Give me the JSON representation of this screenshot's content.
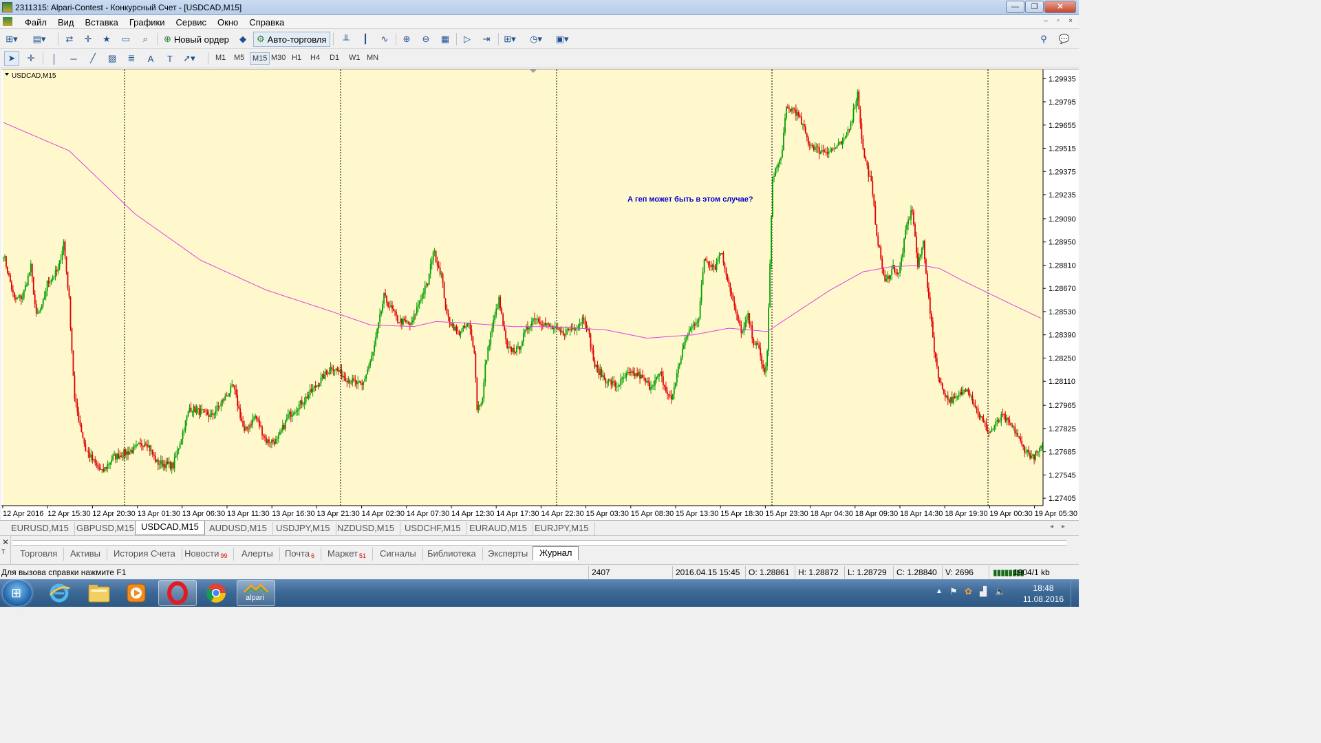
{
  "window": {
    "title": "2311315: Alpari-Contest - Конкурсный Счет - [USDCAD,M15]",
    "buttons": [
      "—",
      "❐",
      "✕"
    ]
  },
  "menu": {
    "items": [
      "Файл",
      "Вид",
      "Вставка",
      "Графики",
      "Сервис",
      "Окно",
      "Справка"
    ],
    "mdi_buttons": [
      "–",
      "▫",
      "×"
    ]
  },
  "toolbar": {
    "new_order_label": "Новый ордер",
    "auto_trading_label": "Авто-торговля",
    "timeframes": [
      "M1",
      "M5",
      "M15",
      "M30",
      "H1",
      "H4",
      "D1",
      "W1",
      "MN"
    ],
    "active_timeframe": "M15"
  },
  "chart": {
    "symbol_label": "USDCAD,M15",
    "annotation": "А геп может быть в этом случае?",
    "background_color": "#fff8cd",
    "bull_color": "#00a000",
    "bear_color": "#e00000",
    "ma_color": "#e040e0",
    "annotation_color": "#0000d0"
  },
  "chart_data": {
    "type": "candlestick",
    "symbol": "USDCAD",
    "timeframe": "M15",
    "y_ticks": [
      "1.29935",
      "1.29795",
      "1.29655",
      "1.29515",
      "1.29375",
      "1.29235",
      "1.29090",
      "1.28950",
      "1.28810",
      "1.28670",
      "1.28530",
      "1.28390",
      "1.28250",
      "1.28110",
      "1.27965",
      "1.27825",
      "1.27685",
      "1.27545",
      "1.27405"
    ],
    "ylim": [
      1.2736,
      1.2999
    ],
    "x_ticks": [
      "12 Apr 2016",
      "12 Apr 15:30",
      "12 Apr 20:30",
      "13 Apr 01:30",
      "13 Apr 06:30",
      "13 Apr 11:30",
      "13 Apr 16:30",
      "13 Apr 21:30",
      "14 Apr 02:30",
      "14 Apr 07:30",
      "14 Apr 12:30",
      "14 Apr 17:30",
      "14 Apr 22:30",
      "15 Apr 03:30",
      "15 Apr 08:30",
      "15 Apr 13:30",
      "15 Apr 18:30",
      "15 Apr 23:30",
      "18 Apr 04:30",
      "18 Apr 09:30",
      "18 Apr 14:30",
      "18 Apr 19:30",
      "19 Apr 00:30",
      "19 Apr 05:30"
    ],
    "day_separators": [
      "13 Apr",
      "14 Apr",
      "15 Apr",
      "18 Apr",
      "19 Apr"
    ],
    "price_anchors": [
      [
        0,
        1.2888
      ],
      [
        8,
        1.286
      ],
      [
        14,
        1.2862
      ],
      [
        20,
        1.288
      ],
      [
        24,
        1.285
      ],
      [
        28,
        1.2855
      ],
      [
        32,
        1.287
      ],
      [
        40,
        1.2878
      ],
      [
        44,
        1.2895
      ],
      [
        48,
        1.286
      ],
      [
        52,
        1.28
      ],
      [
        60,
        1.277
      ],
      [
        68,
        1.276
      ],
      [
        72,
        1.2756
      ],
      [
        80,
        1.2765
      ],
      [
        96,
        1.277
      ],
      [
        104,
        1.2775
      ],
      [
        112,
        1.2762
      ],
      [
        124,
        1.276
      ],
      [
        136,
        1.2795
      ],
      [
        152,
        1.279
      ],
      [
        168,
        1.2808
      ],
      [
        176,
        1.278
      ],
      [
        184,
        1.279
      ],
      [
        192,
        1.2775
      ],
      [
        200,
        1.2775
      ],
      [
        208,
        1.279
      ],
      [
        220,
        1.28
      ],
      [
        232,
        1.2812
      ],
      [
        240,
        1.282
      ],
      [
        252,
        1.2812
      ],
      [
        262,
        1.2808
      ],
      [
        270,
        1.2828
      ],
      [
        278,
        1.2862
      ],
      [
        288,
        1.2848
      ],
      [
        298,
        1.2845
      ],
      [
        304,
        1.286
      ],
      [
        310,
        1.287
      ],
      [
        314,
        1.289
      ],
      [
        320,
        1.2875
      ],
      [
        324,
        1.285
      ],
      [
        332,
        1.284
      ],
      [
        340,
        1.2845
      ],
      [
        344,
        1.283
      ],
      [
        346,
        1.2795
      ],
      [
        350,
        1.28
      ],
      [
        352,
        1.282
      ],
      [
        356,
        1.284
      ],
      [
        362,
        1.286
      ],
      [
        368,
        1.283
      ],
      [
        376,
        1.283
      ],
      [
        382,
        1.2842
      ],
      [
        388,
        1.285
      ],
      [
        396,
        1.2845
      ],
      [
        408,
        1.284
      ],
      [
        420,
        1.2845
      ],
      [
        424,
        1.285
      ],
      [
        428,
        1.2838
      ],
      [
        432,
        1.282
      ],
      [
        440,
        1.2812
      ],
      [
        448,
        1.2808
      ],
      [
        456,
        1.2815
      ],
      [
        464,
        1.2815
      ],
      [
        472,
        1.2808
      ],
      [
        480,
        1.2815
      ],
      [
        484,
        1.2805
      ],
      [
        488,
        1.28
      ],
      [
        496,
        1.283
      ],
      [
        500,
        1.284
      ],
      [
        508,
        1.285
      ],
      [
        512,
        1.2885
      ],
      [
        520,
        1.288
      ],
      [
        524,
        1.289
      ],
      [
        530,
        1.287
      ],
      [
        536,
        1.2848
      ],
      [
        540,
        1.284
      ],
      [
        544,
        1.285
      ],
      [
        548,
        1.2835
      ],
      [
        552,
        1.283
      ],
      [
        556,
        1.2815
      ],
      [
        558,
        1.2828
      ],
      [
        562,
        1.2935
      ],
      [
        568,
        1.2945
      ],
      [
        572,
        1.2975
      ],
      [
        578,
        1.2975
      ],
      [
        584,
        1.2965
      ],
      [
        588,
        1.2955
      ],
      [
        596,
        1.295
      ],
      [
        604,
        1.295
      ],
      [
        614,
        1.2955
      ],
      [
        620,
        1.297
      ],
      [
        624,
        1.2985
      ],
      [
        628,
        1.295
      ],
      [
        634,
        1.293
      ],
      [
        638,
        1.29
      ],
      [
        644,
        1.287
      ],
      [
        650,
        1.288
      ],
      [
        654,
        1.2875
      ],
      [
        660,
        1.2905
      ],
      [
        664,
        1.2915
      ],
      [
        668,
        1.288
      ],
      [
        672,
        1.2895
      ],
      [
        676,
        1.286
      ],
      [
        680,
        1.283
      ],
      [
        684,
        1.281
      ],
      [
        690,
        1.28
      ],
      [
        696,
        1.28
      ],
      [
        704,
        1.2808
      ],
      [
        712,
        1.2792
      ],
      [
        720,
        1.278
      ],
      [
        730,
        1.279
      ],
      [
        740,
        1.278
      ],
      [
        744,
        1.2772
      ],
      [
        752,
        1.2765
      ],
      [
        758,
        1.277
      ]
    ],
    "moving_average_anchors": [
      [
        0,
        1.2967
      ],
      [
        48,
        1.295
      ],
      [
        96,
        1.2912
      ],
      [
        144,
        1.2884
      ],
      [
        192,
        1.2866
      ],
      [
        240,
        1.2853
      ],
      [
        268,
        1.2845
      ],
      [
        300,
        1.2844
      ],
      [
        316,
        1.2847
      ],
      [
        340,
        1.2846
      ],
      [
        372,
        1.2844
      ],
      [
        400,
        1.2844
      ],
      [
        440,
        1.2842
      ],
      [
        470,
        1.2837
      ],
      [
        504,
        1.2839
      ],
      [
        530,
        1.2843
      ],
      [
        558,
        1.2841
      ],
      [
        580,
        1.2853
      ],
      [
        604,
        1.2866
      ],
      [
        628,
        1.2877
      ],
      [
        648,
        1.288
      ],
      [
        670,
        1.2881
      ],
      [
        684,
        1.2879
      ],
      [
        700,
        1.2872
      ],
      [
        720,
        1.2864
      ],
      [
        740,
        1.2856
      ],
      [
        758,
        1.2849
      ]
    ]
  },
  "symbol_tabs": [
    "EURUSD,M15",
    "GBPUSD,M15",
    "USDCAD,M15",
    "AUDUSD,M15",
    "USDJPY,M15",
    "NZDUSD,M15",
    "USDCHF,M15",
    "EURAUD,M15",
    "EURJPY,M15"
  ],
  "active_symbol_tab": "USDCAD,M15",
  "terminal": {
    "side_label": "Т",
    "tabs": [
      {
        "label": "Торговля",
        "badge": ""
      },
      {
        "label": "Активы",
        "badge": ""
      },
      {
        "label": "История Счета",
        "badge": ""
      },
      {
        "label": "Новости",
        "badge": "99"
      },
      {
        "label": "Алерты",
        "badge": ""
      },
      {
        "label": "Почта",
        "badge": "6"
      },
      {
        "label": "Маркет",
        "badge": "51"
      },
      {
        "label": "Сигналы",
        "badge": ""
      },
      {
        "label": "Библиотека",
        "badge": ""
      },
      {
        "label": "Эксперты",
        "badge": ""
      },
      {
        "label": "Журнал",
        "badge": ""
      }
    ],
    "active_tab": "Журнал"
  },
  "status": {
    "help": "Для вызова справки нажмите F1",
    "bars": "2407",
    "datetime": "2016.04.15 15:45",
    "open": "O: 1.28861",
    "high": "H: 1.28872",
    "low": "L: 1.28729",
    "close": "C: 1.28840",
    "volume": "V: 2696",
    "traffic": "1904/1 kb"
  },
  "taskbar": {
    "apps": [
      "windows-start",
      "internet-explorer",
      "file-explorer",
      "media-player",
      "opera",
      "chrome",
      "alpari"
    ],
    "alpari_label": "alpari",
    "time": "18:48",
    "date": "11.08.2016"
  }
}
